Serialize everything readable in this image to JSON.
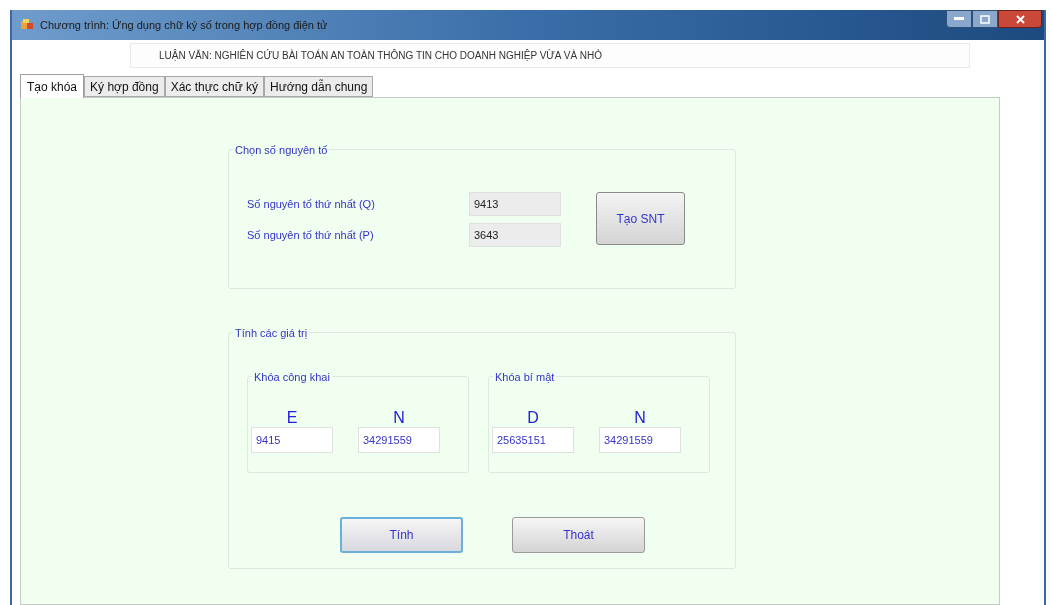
{
  "window": {
    "title": "Chương trình: Ứng dụng chữ ký số trong hợp đồng điện tử"
  },
  "header": {
    "value": "LUẬN VĂN: NGHIÊN CỨU BÀI TOÁN AN TOÀN THÔNG TIN CHO DOANH NGHIỆP VỪA VÀ NHỎ"
  },
  "tabs": [
    {
      "label": "Tạo khóa",
      "selected": true
    },
    {
      "label": "Ký hợp đồng",
      "selected": false
    },
    {
      "label": "Xác thực chữ ký",
      "selected": false
    },
    {
      "label": "Hướng dẫn chung",
      "selected": false
    }
  ],
  "prime_group": {
    "title": "Chọn số nguyên tố",
    "rows": [
      {
        "label": "Số nguyên tố thứ nhất (Q)",
        "value": "9413"
      },
      {
        "label": "Số nguyên tố thứ nhất (P)",
        "value": "3643"
      }
    ],
    "button": "Tạo SNT"
  },
  "compute_group": {
    "title": "Tính các giá trị",
    "keys": [
      {
        "title": "Khóa công khai",
        "fields": [
          {
            "label": "E",
            "value": "9415"
          },
          {
            "label": "N",
            "value": "34291559"
          }
        ]
      },
      {
        "title": "Khóa bí mật",
        "fields": [
          {
            "label": "D",
            "value": "25635151"
          },
          {
            "label": "N",
            "value": "34291559"
          }
        ]
      }
    ],
    "buttons": [
      "Tính",
      "Thoát"
    ]
  }
}
